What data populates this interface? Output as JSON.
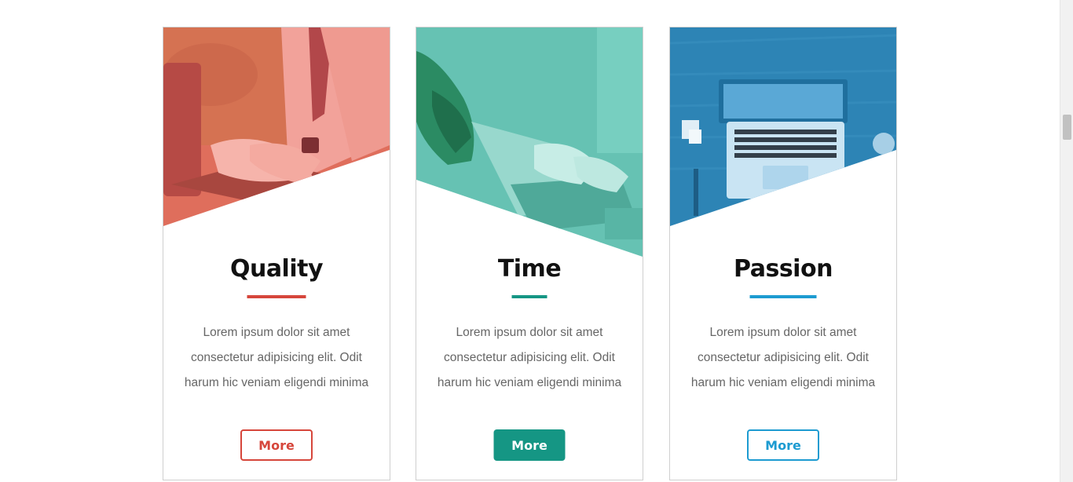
{
  "cards": [
    {
      "title": "Quality",
      "text": "Lorem ipsum dolor sit amet consectetur adipisicing elit. Odit harum hic veniam eligendi minima",
      "button_label": "More",
      "accent": "#d6463b",
      "button_style": "outline"
    },
    {
      "title": "Time",
      "text": "Lorem ipsum dolor sit amet consectetur adipisicing elit. Odit harum hic veniam eligendi minima",
      "button_label": "More",
      "accent": "#159684",
      "button_style": "filled"
    },
    {
      "title": "Passion",
      "text": "Lorem ipsum dolor sit amet consectetur adipisicing elit. Odit harum hic veniam eligendi minima",
      "button_label": "More",
      "accent": "#1d9bd1",
      "button_style": "outline"
    }
  ]
}
